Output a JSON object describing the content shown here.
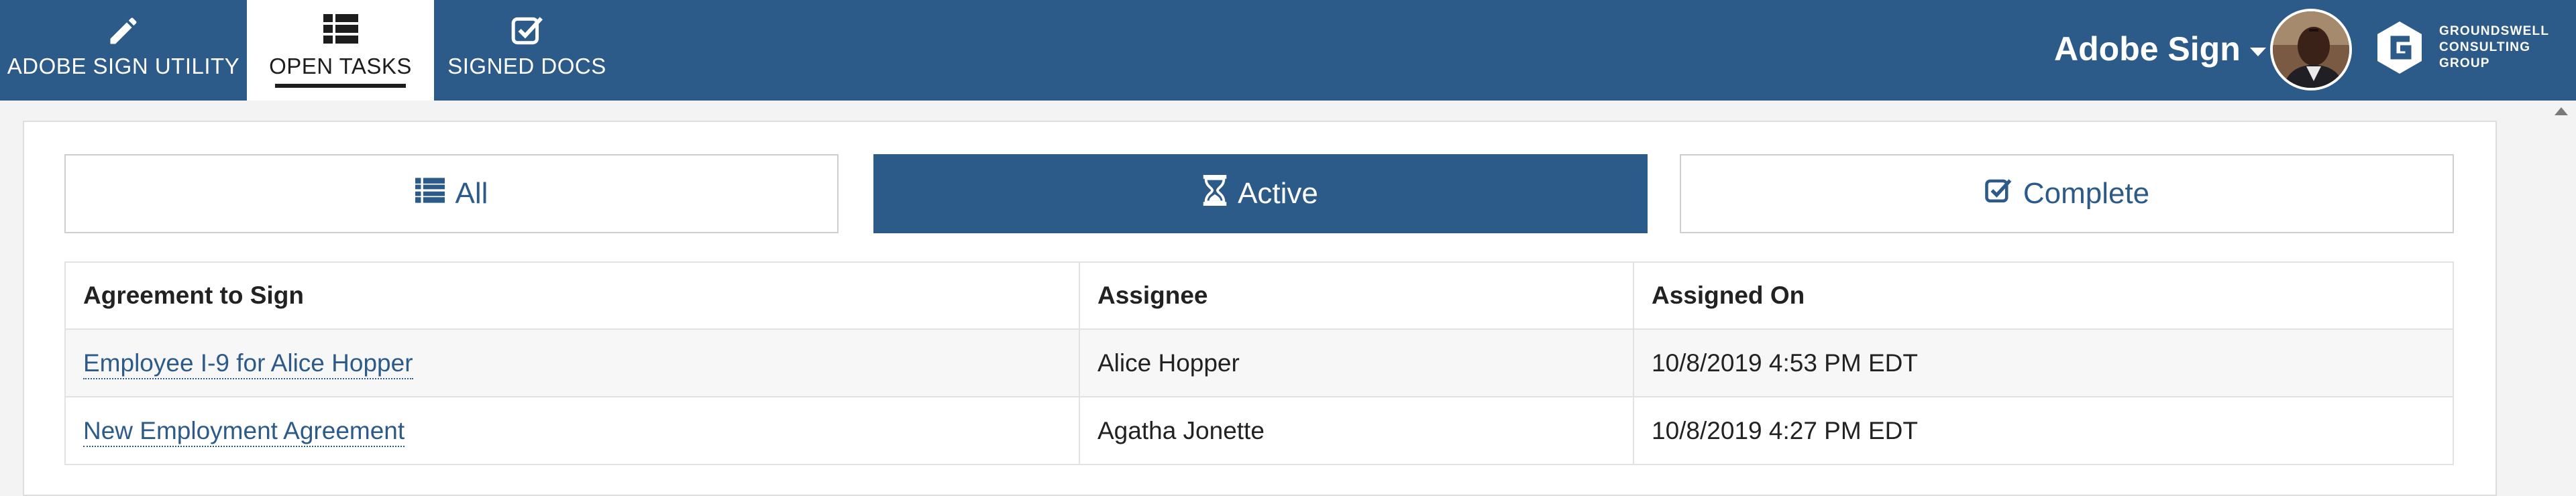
{
  "nav": {
    "tabs": [
      {
        "label": "ADOBE SIGN UTILITY",
        "icon": "pencil-icon",
        "active": false
      },
      {
        "label": "OPEN TASKS",
        "icon": "list-icon",
        "active": true
      },
      {
        "label": "SIGNED DOCS",
        "icon": "checkbox-icon",
        "active": false
      }
    ],
    "user_menu_label": "Adobe Sign",
    "logo_text": "GROUNDSWELL\nCONSULTING\nGROUP"
  },
  "filters": {
    "all": "All",
    "active": "Active",
    "complete": "Complete",
    "selected": "Active"
  },
  "table": {
    "headers": [
      "Agreement to Sign",
      "Assignee",
      "Assigned On"
    ],
    "rows": [
      {
        "agreement": "Employee I-9 for Alice Hopper",
        "assignee": "Alice Hopper",
        "assigned_on": "10/8/2019 4:53 PM EDT"
      },
      {
        "agreement": "New Employment Agreement",
        "assignee": "Agatha Jonette",
        "assigned_on": "10/8/2019 4:27 PM EDT"
      }
    ]
  },
  "colors": {
    "brand": "#2c5b89",
    "background": "#f3f3f3",
    "card": "#ffffff"
  }
}
